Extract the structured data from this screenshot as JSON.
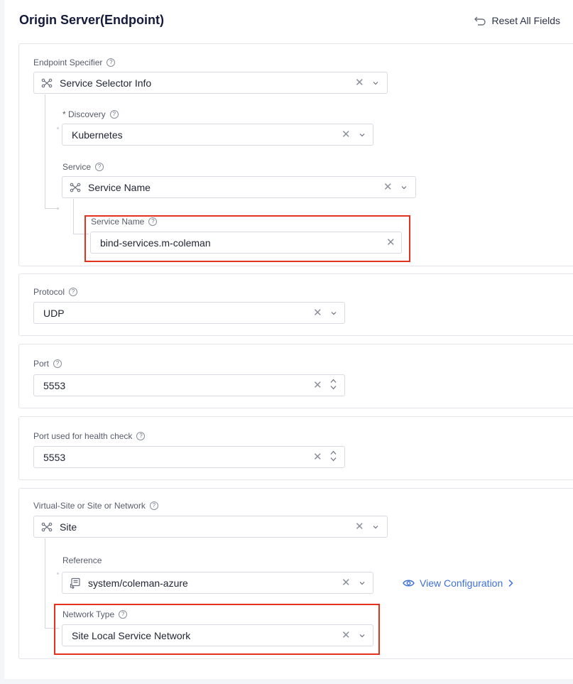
{
  "header": {
    "title": "Origin Server(Endpoint)",
    "reset_label": "Reset All Fields"
  },
  "endpoint": {
    "specifier_label": "Endpoint Specifier",
    "specifier_value": "Service Selector Info",
    "discovery_label": "* Discovery",
    "discovery_value": "Kubernetes",
    "service_label": "Service",
    "service_value": "Service Name",
    "service_name_label": "Service Name",
    "service_name_value": "bind-services.m-coleman"
  },
  "protocol": {
    "label": "Protocol",
    "value": "UDP"
  },
  "port": {
    "label": "Port",
    "value": "5553"
  },
  "health_port": {
    "label": "Port used for health check",
    "value": "5553"
  },
  "site": {
    "label": "Virtual-Site or Site or Network",
    "value": "Site",
    "reference_label": "Reference",
    "reference_value": "system/coleman-azure",
    "view_config_label": "View Configuration",
    "network_type_label": "Network Type",
    "network_type_value": "Site Local Service Network"
  },
  "colors": {
    "accent": "#3e6fd8",
    "highlight": "#e5321f"
  },
  "icons": [
    "reset-icon",
    "help-icon",
    "selector-icon",
    "clear-icon",
    "chevron-down-icon",
    "stepper-icon",
    "reference-icon",
    "eye-icon",
    "chevron-right-icon"
  ]
}
